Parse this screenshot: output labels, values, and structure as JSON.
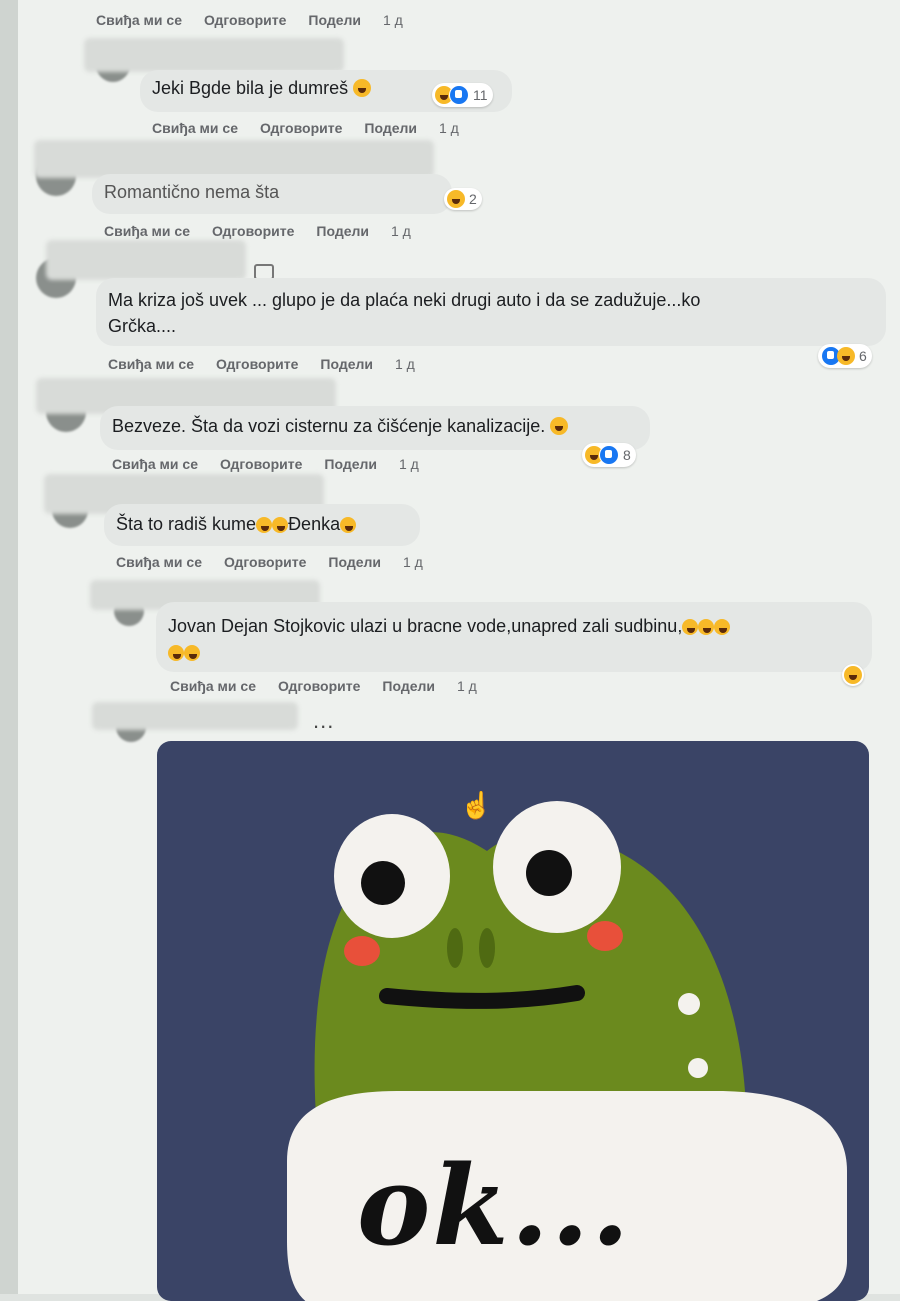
{
  "actions": {
    "like": "Свиђа ми се",
    "reply": "Одговорите",
    "share": "Подели",
    "time": "1 д"
  },
  "comments": [
    {
      "text": "Jeki Bgde bila je dumreš",
      "reaction_count": "11"
    },
    {
      "text": "Romantično nema šta",
      "reaction_count": "2"
    },
    {
      "text_line1": "Ma kriza još uvek ... glupo je da plaća neki drugi auto i da se zadužuje...ko",
      "text_line2": "Grčka....",
      "reaction_count": "6"
    },
    {
      "text": "Bezveze. Šta da vozi cisternu za čišćenje kanalizacije.",
      "reaction_count": "8"
    },
    {
      "text_part1": "Šta to radiš kume",
      "text_part2": "Đenka"
    },
    {
      "text": "Jovan Dejan Stojkovic ulazi u bracne vode,unapred zali sudbinu,"
    }
  ],
  "more_dots": "...",
  "sticker": {
    "caption": "ok..."
  },
  "colors": {
    "haha": "#f7b928",
    "like": "#1877f2",
    "sticker_bg": "#3a4466",
    "frog": "#6b8a1e"
  }
}
